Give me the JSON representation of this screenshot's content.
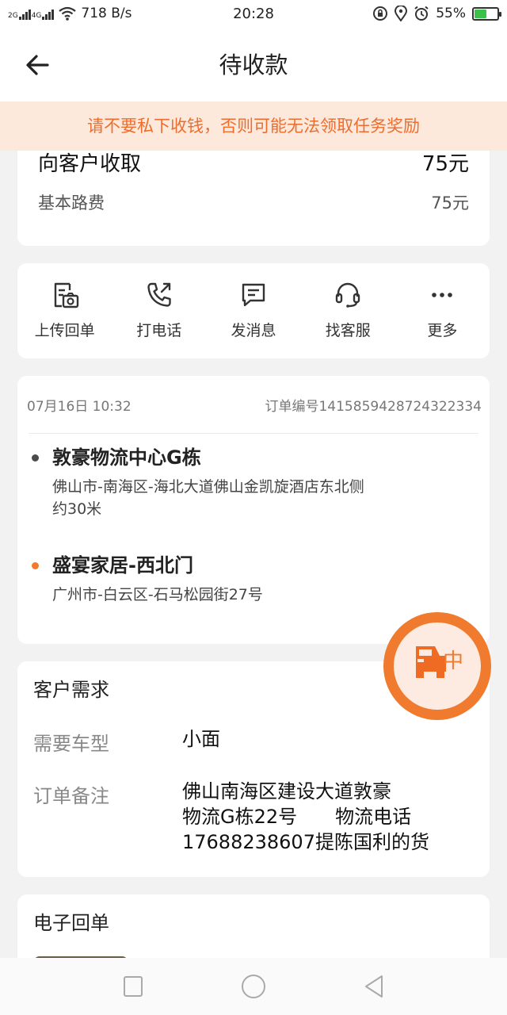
{
  "status_bar": {
    "net_tags": [
      "2G",
      "4G"
    ],
    "speed": "718 B/s",
    "time": "20:28",
    "battery": "55%",
    "battery_level": 0.55,
    "icons": [
      "signal-icon",
      "wifi-icon",
      "vpn-icon",
      "location-icon",
      "alarm-icon",
      "battery-icon"
    ]
  },
  "header": {
    "title": "待收款"
  },
  "banner": {
    "text": "请不要私下收钱，否则可能无法领取任务奖励"
  },
  "fee": {
    "collect_label": "向客户收取",
    "collect_value": "75元",
    "base_label": "基本路费",
    "base_value": "75元"
  },
  "actions": [
    {
      "label": "上传回单",
      "icon": "upload-receipt-icon"
    },
    {
      "label": "打电话",
      "icon": "phone-icon"
    },
    {
      "label": "发消息",
      "icon": "message-icon"
    },
    {
      "label": "找客服",
      "icon": "headset-icon"
    },
    {
      "label": "更多",
      "icon": "more-icon"
    }
  ],
  "order": {
    "datetime": "07月16日 10:32",
    "order_no": "订单编号1415859428724322334",
    "pickup": {
      "name": "敦豪物流中心G栋",
      "addr_line1": "佛山市-南海区-海北大道佛山金凯旋酒店东北侧",
      "addr_line2": "约30米",
      "color": "#4a4a4a"
    },
    "dropoff": {
      "name": "盛宴家居-西北门",
      "addr": "广州市-白云区-石马松园街27号",
      "color": "#f07a2e"
    }
  },
  "float_button": {
    "text": "中",
    "icon": "car-icon"
  },
  "demand": {
    "title": "客户需求",
    "vehicle_label": "需要车型",
    "vehicle_value": "小面",
    "remark_label": "订单备注",
    "remark_lines": [
      "佛山南海区建设大道敦豪",
      "物流G栋22号　　物流电话",
      "17688238607提陈国利的货"
    ]
  },
  "receipt": {
    "title": "电子回单"
  },
  "colors": {
    "accent": "#f07a2e",
    "banner_bg": "#fde8dc",
    "page_bg": "#f2f2f2"
  }
}
